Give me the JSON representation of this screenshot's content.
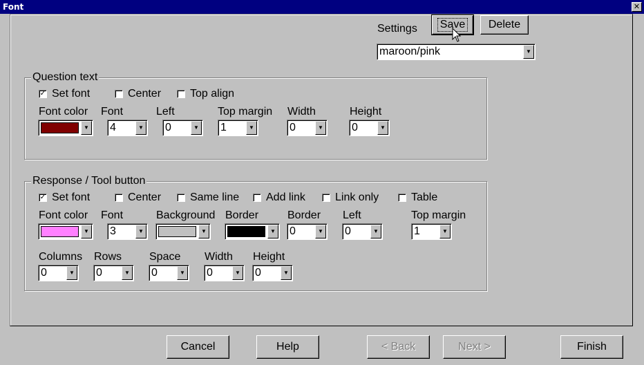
{
  "window": {
    "title": "Font",
    "close_glyph": "✕"
  },
  "settings": {
    "label": "Settings",
    "save_label": "Save",
    "delete_label": "Delete",
    "selected": "maroon/pink"
  },
  "question": {
    "group_label": "Question text",
    "set_font": {
      "label": "Set font",
      "checked": true
    },
    "center": {
      "label": "Center",
      "checked": false
    },
    "top_align": {
      "label": "Top align",
      "checked": false
    },
    "font_color": {
      "label": "Font color",
      "color": "#800000"
    },
    "font": {
      "label": "Font",
      "value": "4"
    },
    "left": {
      "label": "Left",
      "value": "0"
    },
    "top_margin": {
      "label": "Top margin",
      "value": "1"
    },
    "width": {
      "label": "Width",
      "value": "0"
    },
    "height": {
      "label": "Height",
      "value": "0"
    }
  },
  "response": {
    "group_label": "Response / Tool button",
    "set_font": {
      "label": "Set font",
      "checked": true
    },
    "center": {
      "label": "Center",
      "checked": false
    },
    "same_line": {
      "label": "Same line",
      "checked": false
    },
    "add_link": {
      "label": "Add link",
      "checked": false
    },
    "link_only": {
      "label": "Link only",
      "checked": false
    },
    "table": {
      "label": "Table",
      "checked": false
    },
    "font_color": {
      "label": "Font color",
      "color": "#ff80ff"
    },
    "font": {
      "label": "Font",
      "value": "3"
    },
    "background": {
      "label": "Background",
      "color": "#c0c0c0"
    },
    "border_color": {
      "label": "Border",
      "color": "#000000"
    },
    "border": {
      "label": "Border",
      "value": "0"
    },
    "left": {
      "label": "Left",
      "value": "0"
    },
    "top_margin": {
      "label": "Top margin",
      "value": "1"
    },
    "columns": {
      "label": "Columns",
      "value": "0"
    },
    "rows": {
      "label": "Rows",
      "value": "0"
    },
    "space": {
      "label": "Space",
      "value": "0"
    },
    "width": {
      "label": "Width",
      "value": "0"
    },
    "height": {
      "label": "Height",
      "value": "0"
    }
  },
  "footer": {
    "cancel_label": "Cancel",
    "help_label": "Help",
    "back_label": "< Back",
    "next_label": "Next >",
    "finish_label": "Finish"
  },
  "icons": {
    "checkmark": "✓",
    "dropdown": "▼",
    "cursor": "arrow-cursor-icon"
  }
}
